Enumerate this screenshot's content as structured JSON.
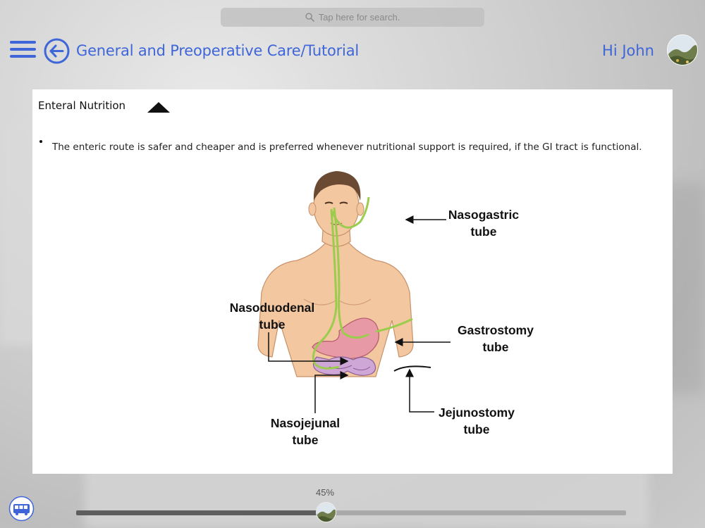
{
  "search": {
    "placeholder": "Tap here for search."
  },
  "header": {
    "title": "General and Preoperative Care/Tutorial",
    "greeting": "Hi John"
  },
  "content": {
    "section_title": "Enteral Nutrition",
    "bullets": [
      "The enteric route is safer and cheaper and is preferred whenever nutritional support is required, if the GI tract is functional."
    ],
    "figure_labels": {
      "nasogastric": [
        "Nasogastric",
        "tube"
      ],
      "nasoduodenal": [
        "Nasoduodenal",
        "tube"
      ],
      "gastrostomy": [
        "Gastrostomy",
        "tube"
      ],
      "jejunostomy": [
        "Jejunostomy",
        "tube"
      ],
      "nasojejunal": [
        "Nasojejunal",
        "tube"
      ]
    }
  },
  "progress": {
    "label": "45%",
    "value": 0.45
  },
  "colors": {
    "accent": "#3f66d9",
    "tube": "#9ccc4e",
    "skin": "#f3c7a0"
  },
  "icons": {
    "menu": "hamburger-icon",
    "back": "back-arrow-icon",
    "search": "search-icon",
    "bus": "bus-icon",
    "collapse": "triangle-up-icon"
  }
}
